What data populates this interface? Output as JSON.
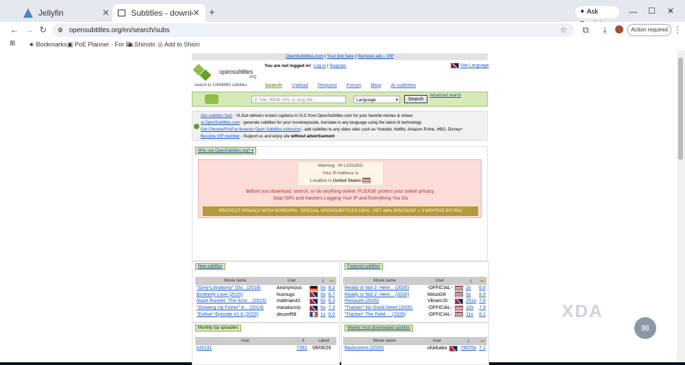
{
  "browser": {
    "tabs": [
      {
        "title": "Jellyfin"
      },
      {
        "title": "Subtitles - download movie and"
      }
    ],
    "url": "opensubtitles.org/en/search/subs",
    "ask_gemini": "Ask Gemini",
    "action_required": "Action required",
    "bookmarks": [
      "Bookmarks",
      "PoE Planner - For Ex...",
      "Shinobi",
      "Add to Shiori"
    ]
  },
  "site": {
    "top_links": [
      "OpenSubtitles.com",
      "Your link here",
      "Remove ads - VIP"
    ],
    "logo_text": "opensubtitles",
    "logo_sub": "org",
    "search_count": "search in 10948993 subtitles",
    "login_msg": "You are not logged in!",
    "login": "Log-in",
    "register": "Register",
    "site_language": "Site Language",
    "nav": [
      "Search",
      "Upload",
      "Request",
      "Forum",
      "Blog",
      "AI subtitles"
    ],
    "search_placeholder": "Title, IMDB URL or drop file...",
    "language_label": "Language",
    "search_button": "Search",
    "advanced_search": "Advanced search",
    "info": [
      {
        "link": "Get subtitles fast!",
        "text": " - VLSub delivers instant captions in VLC from OpenSubtitles.com for your favorite movies & shows"
      },
      {
        "link": "ai.OpenSubtitles.com",
        "text": " - generate subtitles for your movie/episode, translate in any language using the latest AI technology"
      },
      {
        "link": "Get Chrome/FireFox browser Open Subtitles extension",
        "text": " - add subtitles to any video sites such as Youtube, Netflix, Amazon Prime, HBO, Disney+"
      },
      {
        "link": "Become VIP member",
        "text": " - Support us and enjoy site ",
        "bold": "without advertisement"
      }
    ],
    "why_use": "Why use OpenSubtitles.org?",
    "warning": {
      "line1": "Warning : IP-LOGGED",
      "line2": "Your IP Address is",
      "line3_a": "Location is",
      "line3_b": "United States",
      "msg1": "Before you download, search, or do anything online: PLEASE protect your online privacy.",
      "msg2": "Stop ISPs and Hackers Logging Your IP and Everything You Do",
      "banner": "PROTECT PRIVACY WITH NORDVPN - SPECIAL OPENSUBTITLES DEAL: GET 69% DISCOUNT + 3 MONTHS EXTRA!"
    },
    "new_subs": {
      "title": "New subtitles",
      "col_movie": "Movie name",
      "col_user": "User",
      "rows": [
        {
          "movie": "\"Grey's Anatomy\" (Do...(2018)",
          "user": "Anonymous",
          "flag": "de",
          "dl": "0x",
          "rate": "8.2"
        },
        {
          "movie": "Brotherly Love (2015)",
          "user": "husnugs",
          "flag": "gb",
          "dl": "0x",
          "rate": "6.7"
        },
        {
          "movie": "Maze Runner: The Scor... (2015)",
          "user": "maltman42",
          "flag": "gb",
          "dl": "0x",
          "rate": "6.3"
        },
        {
          "movie": "\"Growing Up Fisher\" K... (2014)",
          "user": "masaluccio",
          "flag": "gb",
          "dl": "0x",
          "rate": "7.3"
        },
        {
          "movie": "\"Evilive\" Episode #1.6 (2023)",
          "user": "deuzef68",
          "flag": "fr",
          "dl": "1x",
          "rate": "0.0"
        }
      ]
    },
    "featured_subs": {
      "title": "Featured subtitles",
      "col_movie": "Movie name",
      "col_user": "User",
      "rows": [
        {
          "movie": "Ready or Not 2: Here... (2026)",
          "user": "-OFFICIAL-",
          "flag": "us",
          "dl": "2x",
          "rate": "6.6"
        },
        {
          "movie": "Ready or Not 2: Here... (2026)",
          "user": "MitsoGR",
          "flag": "us",
          "dl": "5x",
          "rate": "6.6"
        },
        {
          "movie": "Pressure (2026)",
          "user": "VikramJS",
          "flag": "gb",
          "dl": "251x",
          "rate": "7.6"
        },
        {
          "movie": "\"Tracker\" No Good Deed (2026)",
          "user": "-OFFICIAL-",
          "flag": "us",
          "dl": "10x",
          "rate": "7.9"
        },
        {
          "movie": "\"Tracker\" The Field ... (2026)",
          "user": "-OFFICIAL-",
          "flag": "us",
          "dl": "11x",
          "rate": "8.1"
        }
      ]
    },
    "uploaders": {
      "title": "Monthly top uploaders",
      "col_user": "User",
      "col_hash": "#",
      "col_latest": "Latest",
      "rows": [
        {
          "user": "ichi131",
          "count": "7261",
          "latest": "08/06/26"
        }
      ]
    },
    "weekly": {
      "title": "Weekly most downloaded subtitles",
      "col_movie": "Movie name",
      "col_user": "User",
      "rows": [
        {
          "movie": "Backrooms (2026)",
          "user": "ufukbaba",
          "flag": "gb",
          "dl": "78076x",
          "rate": "7.1"
        }
      ]
    }
  },
  "overlay": {
    "brand": "XDA"
  },
  "colors": {
    "accent_green": "#d7e9b9",
    "banner_gold": "#b49a3a",
    "warning_bg": "#fbdcd7"
  }
}
